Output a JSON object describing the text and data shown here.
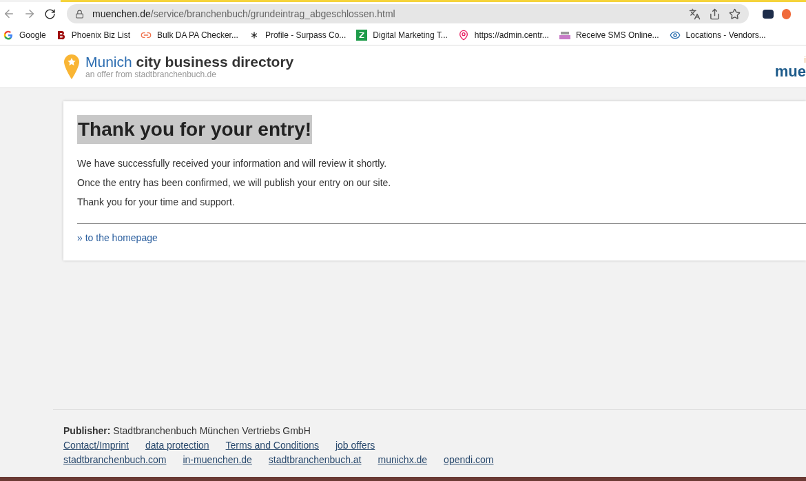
{
  "browser": {
    "url_host": "muenchen.de",
    "url_path": "/service/branchenbuch/grundeintrag_abgeschlossen.html"
  },
  "bookmarks": [
    {
      "label": "Google",
      "kind": "google"
    },
    {
      "label": "Phoenix Biz List",
      "kind": "b"
    },
    {
      "label": "Bulk DA PA Checker...",
      "kind": "link"
    },
    {
      "label": "Profile - Surpass Co...",
      "kind": "asterisk"
    },
    {
      "label": "Digital Marketing T...",
      "kind": "z"
    },
    {
      "label": "https://admin.centr...",
      "kind": "pin"
    },
    {
      "label": "Receive SMS Online...",
      "kind": "sms"
    },
    {
      "label": "Locations - Vendors...",
      "kind": "eye"
    }
  ],
  "header": {
    "title_city": "Munich",
    "title_rest": "city business directory",
    "subtitle": "an offer from stadtbranchenbuch.de",
    "corner_letter": "i",
    "corner_logo": "mue"
  },
  "card": {
    "heading": "Thank you for your entry!",
    "paragraphs": [
      "We have successfully received your information and will review it shortly.",
      "Once the entry has been confirmed, we will publish your entry on our site.",
      "Thank you for your time and support."
    ],
    "link": "» to the homepage"
  },
  "footer": {
    "publisher_label": "Publisher:",
    "publisher": "Stadtbranchenbuch München Vertriebs GmbH",
    "links": [
      "Contact/Imprint",
      "data protection",
      "Terms and Conditions",
      "job offers"
    ],
    "sites": [
      "stadtbranchenbuch.com",
      "in-muenchen.de",
      "stadtbranchenbuch.at",
      "munichx.de",
      "opendi.com"
    ]
  }
}
